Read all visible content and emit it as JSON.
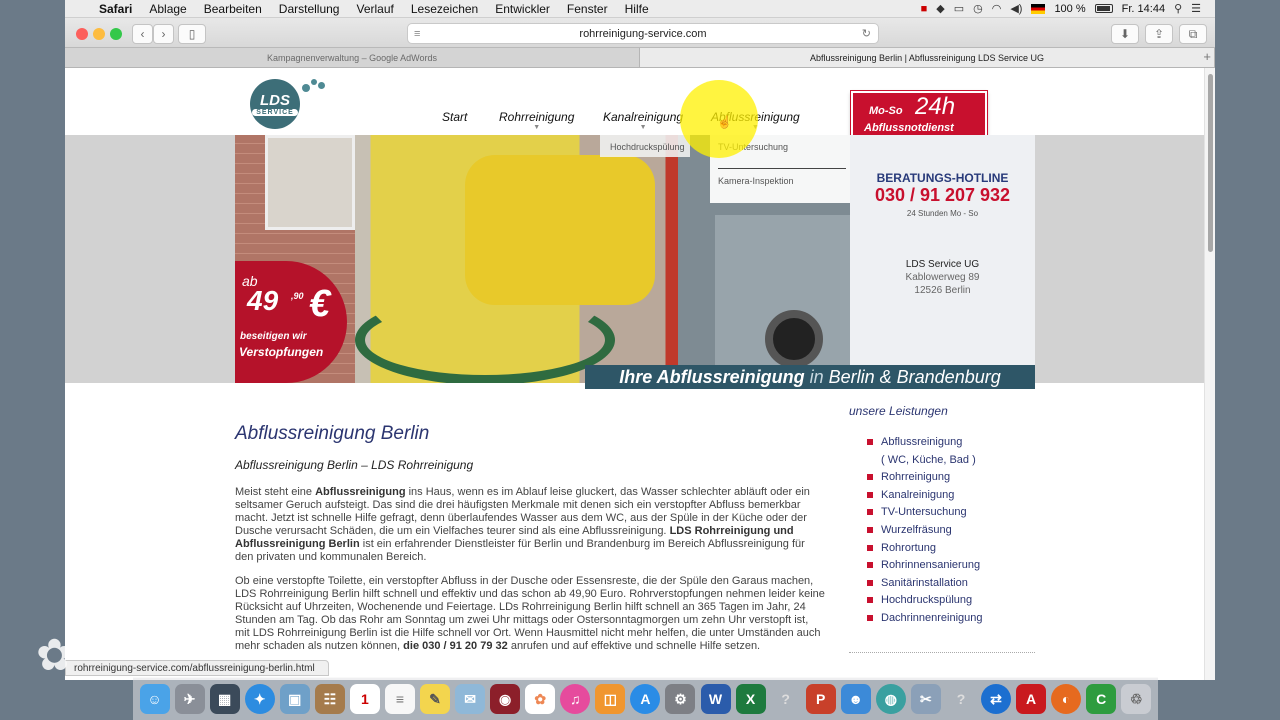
{
  "menubar": {
    "app": "Safari",
    "items": [
      "Ablage",
      "Bearbeiten",
      "Darstellung",
      "Verlauf",
      "Lesezeichen",
      "Entwickler",
      "Fenster",
      "Hilfe"
    ],
    "battery": "100 %",
    "clock": "Fr. 14:44"
  },
  "browser": {
    "url": "rohrreinigung-service.com",
    "tabs": [
      {
        "title": "Kampagnenverwaltung – Google AdWords"
      },
      {
        "title": "Abflussreinigung Berlin | Abflussreinigung LDS Service UG"
      }
    ]
  },
  "site": {
    "logo": {
      "line1": "LDS",
      "line2": "SERVICE"
    },
    "nav": [
      "Start",
      "Rohrreinigung",
      "Kanalreinigung",
      "Abflussreinigung"
    ],
    "dropdown_kanal": [
      "Hochdruckspülung"
    ],
    "dropdown_abfluss": [
      "TV-Untersuchung",
      "Kamera-Inspektion"
    ],
    "badge": {
      "days": "Mo-So",
      "hours": "24h",
      "label": "Abflussnotdienst"
    },
    "price": {
      "prefix": "ab",
      "amount": "49",
      "cents": ",90",
      "currency": "€",
      "line1": "beseitigen wir",
      "line2": "Verstopfungen"
    },
    "contact": {
      "hotline_label": "BERATUNGS-HOTLINE",
      "phone": "030 / 91 207 932",
      "hours": "24 Stunden Mo - So",
      "company": "LDS Service UG",
      "street": "Kablowerweg 89",
      "city": "12526 Berlin"
    },
    "banner": {
      "part1": "Ihre Abflussreinigung",
      "part2": "in",
      "part3": "Berlin & Brandenburg"
    },
    "content": {
      "title": "Abflussreinigung Berlin",
      "subtitle": "Abflussreinigung Berlin – LDS Rohrreinigung",
      "p1_a": "Meist steht eine ",
      "p1_b": "Abflussreinigung",
      "p1_c": " ins Haus, wenn es im Ablauf leise gluckert, das Wasser schlechter abläuft oder ein seltsamer Geruch aufsteigt. Das sind die drei häufigsten Merkmale mit denen sich ein verstopfter Abfluss bemerkbar macht. Jetzt ist schnelle Hilfe gefragt, denn überlaufendes Wasser aus dem WC, aus der Spüle in der Küche oder der Dusche verursacht Schäden, die um ein Vielfaches teurer sind als eine Abflussreinigung. ",
      "p1_d": "LDS Rohrreinigung und Abflussreinigung Berlin",
      "p1_e": " ist ein erfahrender Dienstleister für Berlin und Brandenburg im Bereich Abflussreinigung für den privaten und kommunalen Bereich.",
      "p2_a": "Ob eine verstopfte Toilette, ein verstopfter Abfluss in der Dusche oder Essensreste, die der Spüle den Garaus machen, LDS Rohrreinigung Berlin hilft schnell und effektiv und das schon ab 49,90 Euro. Rohrverstopfungen nehmen leider keine Rücksicht auf Uhrzeiten, Wochenende und Feiertage. LDs Rohrreinigung Berlin hilft schnell an 365 Tagen im Jahr, 24 Stunden am Tag. Ob das Rohr am Sonntag um zwei Uhr mittags oder Ostersonntagmorgen um zehn Uhr verstopft ist, mit LDS Rohrreinigung Berlin ist die Hilfe schnell vor Ort. Wenn Hausmittel nicht mehr helfen, die unter Umständen auch mehr schaden als nutzen können, ",
      "p2_b": "die 030 / 91 20 79 32",
      "p2_c": " anrufen und auf effektive und schnelle Hilfe setzen."
    },
    "sidebar": {
      "title": "unsere Leistungen",
      "items": [
        "Abflussreinigung",
        "( WC, Küche, Bad )",
        "Rohrreinigung",
        "Kanalreinigung",
        "TV-Untersuchung",
        "Wurzelfräsung",
        "Rohrortung",
        "Rohrinnensanierung",
        "Sanitärinstallation",
        "Hochdruckspülung",
        "Dachrinnenreinigung"
      ]
    }
  },
  "status_url": "rohrreinigung-service.com/abflussreinigung-berlin.html",
  "dock": [
    "finder-icon",
    "launchpad-icon",
    "mission-control-icon",
    "safari-icon",
    "preview-icon",
    "contacts-icon",
    "calendar-icon",
    "reminders-icon",
    "notes-icon",
    "messages-icon",
    "photo-booth-icon",
    "photos-icon",
    "itunes-icon",
    "ibooks-icon",
    "app-store-icon",
    "system-preferences-icon",
    "word-icon",
    "excel-icon",
    "help-icon",
    "powerpoint-icon",
    "user-icon",
    "network-icon",
    "tool-icon",
    "help-icon-2",
    "teamviewer-icon",
    "acrobat-icon",
    "firefox-icon",
    "camtasia-icon",
    "trash-icon"
  ]
}
